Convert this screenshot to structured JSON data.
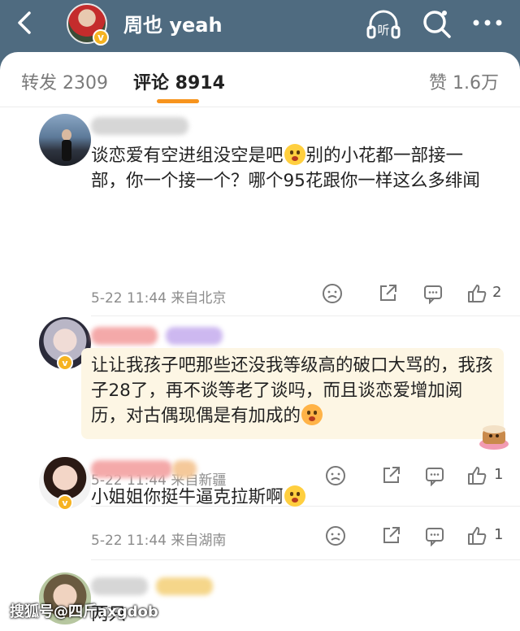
{
  "header": {
    "user_name": "周也 yeah",
    "back_icon": "back-arrow-icon",
    "listen_label": "听",
    "colors": {
      "bar": "#4f6b80",
      "verified": "#f6b321",
      "accent": "#f7941d"
    }
  },
  "tabs": {
    "repost": "转发 2309",
    "comment": "评论 8914",
    "like": "赞 1.6万"
  },
  "comments": [
    {
      "text_a": "谈恋爱有空进组没空是吧",
      "text_b": "别的小花都一部接一部，你一个接一个？哪个95花跟你一样这么多绯闻",
      "time": "5-22 11:44",
      "location": "来自北京",
      "likes": "2"
    },
    {
      "text": "让让我孩子吧那些还没我等级高的破口大骂的，我孩子28了，再不谈等老了谈吗，而且谈恋爱增加阅历，对古偶现偶是有加成的",
      "time": "5-22 11:44",
      "location": "来自新疆",
      "likes": "1"
    },
    {
      "text": "小姐姐你挺牛逼克拉斯啊",
      "time": "5-22 11:44",
      "location": "来自湖南",
      "likes": "1"
    },
    {
      "text": "两只"
    }
  ],
  "watermark": "搜狐号@四斤axgdob"
}
